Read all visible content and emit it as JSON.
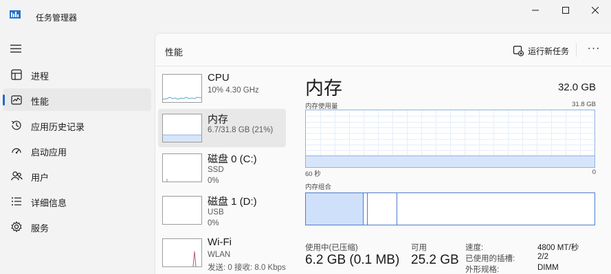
{
  "window": {
    "title": "任务管理器"
  },
  "sidebar": {
    "items": [
      {
        "label": "进程",
        "icon": "processes-icon"
      },
      {
        "label": "性能",
        "icon": "performance-icon",
        "active": true
      },
      {
        "label": "应用历史记录",
        "icon": "history-icon"
      },
      {
        "label": "启动应用",
        "icon": "startup-icon"
      },
      {
        "label": "用户",
        "icon": "users-icon"
      },
      {
        "label": "详细信息",
        "icon": "details-icon"
      },
      {
        "label": "服务",
        "icon": "services-icon"
      }
    ]
  },
  "header": {
    "title": "性能",
    "run_task_label": "运行新任务",
    "more_label": "···"
  },
  "perf_list": [
    {
      "name": "CPU",
      "sub1": "10%  4.30 GHz",
      "sub2": ""
    },
    {
      "name": "内存",
      "sub1": "6.7/31.8 GB (21%)",
      "sub2": "",
      "active": true
    },
    {
      "name": "磁盘 0 (C:)",
      "sub1": "SSD",
      "sub2": "0%"
    },
    {
      "name": "磁盘 1 (D:)",
      "sub1": "USB",
      "sub2": "0%"
    },
    {
      "name": "Wi-Fi",
      "sub1": "WLAN",
      "sub2": "发送: 0 接收: 8.0 Kbps"
    }
  ],
  "detail": {
    "title": "内存",
    "total": "32.0 GB",
    "usage_label": "内存使用量",
    "usage_max": "31.8 GB",
    "axis_left": "60 秒",
    "axis_right": "0",
    "composition_label": "内存组合",
    "usage_fraction": 0.21,
    "in_use_label": "使用中(已压缩)",
    "in_use_value": "6.2 GB (0.1 MB)",
    "available_label": "可用",
    "available_value": "25.2 GB",
    "specs": [
      {
        "key": "速度:",
        "value": "4800 MT/秒"
      },
      {
        "key": "已使用的插槽:",
        "value": "2/2"
      },
      {
        "key": "外形规格:",
        "value": "DIMM"
      }
    ]
  },
  "colors": {
    "accent": "#2764c5",
    "memory_fill": "#d7e5fb",
    "memory_line": "#8fb1e6"
  }
}
